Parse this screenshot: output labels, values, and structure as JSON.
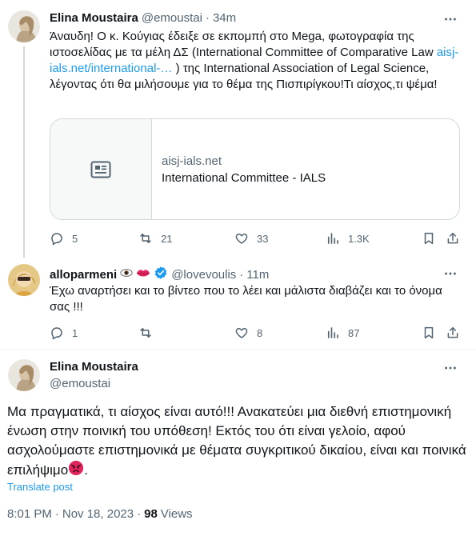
{
  "tweet1": {
    "author_name": "Elina Moustaira",
    "handle": "@emoustai",
    "separator": "·",
    "time": "34m",
    "text_1": "Άναυδη! Ο κ. Κούγιας έδειξε σε εκπομπή στο Mega, φωτογραφία της ιστοσελίδας με τα μέλη ΔΣ (International Committee of Comparative Law ",
    "link_text": "aisj-ials.net/international-…",
    "text_2": " ) της International Association of Legal Science, λέγοντας ότι θα μιλήσουμε για το θέμα της Πισπιρίγκου!Τι αίσχος,τι ψέμα!",
    "card": {
      "domain": "aisj-ials.net",
      "title": "International Committee - IALS",
      "thumb_icon": "article-icon"
    },
    "metrics": {
      "replies": "5",
      "retweets": "21",
      "likes": "33",
      "views": "1.3K"
    }
  },
  "tweet2": {
    "author_name": "alloparmeni",
    "author_emojis": [
      "eye-emoji",
      "lips-emoji"
    ],
    "verified_badge": "verified-icon",
    "handle": "@lovevoulis",
    "separator": "·",
    "time": "11m",
    "text": "Έχω αναρτήσει και το βίντεο που το λέει και μάλιστα διαβάζει και το όνομα σας !!!",
    "metrics": {
      "replies": "1",
      "retweets": "",
      "likes": "8",
      "views": "87"
    }
  },
  "tweet3": {
    "author_name": "Elina Moustaira",
    "handle": "@emoustai",
    "text": "Μα πραγματικά, τι αίσχος είναι αυτό!!! Ανακατεύει μια διεθνή επιστημονική ένωση στην ποινική του υπόθεση! Εκτός του ότι είναι γελοίο, αφού ασχολούμαστε επιστημονικά με θέματα συγκριτικού δικαίου, είναι και ποινικά επιλήψιμο",
    "text_emoji": "angry-face-emoji",
    "translate_label": "Translate post",
    "time": "8:01 PM",
    "separator": "·",
    "date": "Nov 18, 2023",
    "views_count": "98",
    "views_label": "Views"
  },
  "colors": {
    "accent": "#1d9bf0",
    "text": "#0f1419",
    "muted": "#536471",
    "border": "#cfd9de"
  }
}
